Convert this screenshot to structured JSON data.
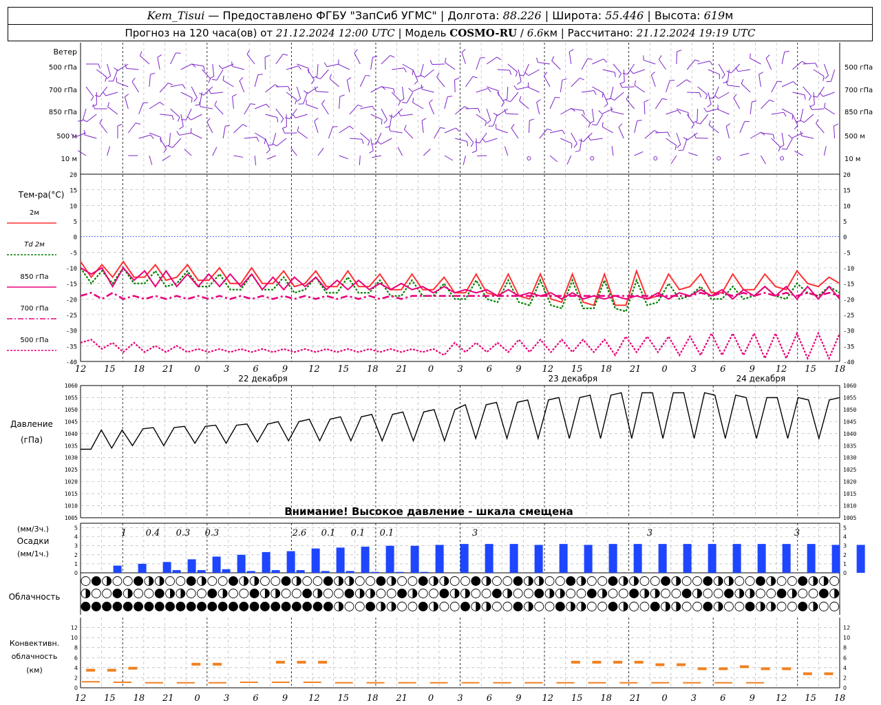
{
  "header": {
    "station": "Kem_Tisui",
    "provider": "Предоставлено ФГБУ \"ЗапСиб УГМС\"",
    "lon_label": "Долгота:",
    "lon": "88.226",
    "lat_label": "Широта:",
    "lat": "55.446",
    "alt_label": "Высота:",
    "alt": "619",
    "alt_unit": "м",
    "forecast_prefix": "Прогноз на 120 часа(ов) от",
    "run_time": "21.12.2024 12:00 UTC",
    "model_label": "Модель",
    "model": "COSMO-RU",
    "resolution": "6.6",
    "res_unit": "км",
    "calc_label": "Рассчитано:",
    "calc_time": "21.12.2024 19:19 UTC"
  },
  "labels": {
    "wind": "Ветер",
    "wind_levels": [
      "500 гПа",
      "700 гПа",
      "850 гПа",
      "500 м",
      "10  м"
    ],
    "temp_title": "Тем-ра(°C)",
    "legend": [
      "2м",
      "Td  2м",
      "850 гПа",
      "700 гПа",
      "500 гПа"
    ],
    "pressure": "Давление",
    "pressure_unit": "(гПа)",
    "warning": "Внимание! Высокое давление - шкала смещена",
    "precip_unit3": "(мм/3ч.)",
    "precip": "Осадки",
    "precip_unit1": "(мм/1ч.)",
    "cloud": "Облачность",
    "conv": [
      "Конвективн.",
      "облачность",
      "(км)"
    ]
  },
  "colors": {
    "t2m": "#ff3030",
    "td2m": "#008000",
    "t850": "#e8007a",
    "t700": "#e8007a",
    "t500": "#e8007a",
    "wind": "#7b22c8",
    "pressure": "#000000",
    "precip": "#1e46ff",
    "conv": "#f08020",
    "zero": "#3050ff"
  },
  "chart_data": [
    {
      "type": "line",
      "title": "Тем-ра(°C)",
      "x_start": "21.12.2024 12:00 UTC",
      "x_step_hours": 3,
      "ylim": [
        -40,
        20
      ],
      "yticks": [
        20,
        15,
        10,
        5,
        0,
        -5,
        -10,
        -15,
        -20,
        -25,
        -30,
        -35,
        -40
      ],
      "xtick_labels": [
        "12",
        "15",
        "18",
        "21",
        "0",
        "3",
        "6",
        "9",
        "12",
        "15",
        "18",
        "21",
        "0",
        "3",
        "6",
        "9",
        "12",
        "15",
        "18",
        "21",
        "0",
        "3",
        "6",
        "9",
        "12",
        "15",
        "18"
      ],
      "day_labels": [
        "22 декабря",
        "23 декабря",
        "24 декабря"
      ],
      "series": [
        {
          "name": "2м",
          "values": [
            -8,
            -13,
            -9,
            -13,
            -8,
            -13,
            -13,
            -9,
            -14,
            -13,
            -9,
            -14,
            -14,
            -10,
            -15,
            -15,
            -10,
            -15,
            -15,
            -11,
            -16,
            -15,
            -11,
            -16,
            -16,
            -11,
            -16,
            -16,
            -12,
            -17,
            -17,
            -12,
            -17,
            -17,
            -13,
            -18,
            -18,
            -12,
            -18,
            -19,
            -12,
            -19,
            -20,
            -12,
            -20,
            -21,
            -12,
            -21,
            -22,
            -12,
            -22,
            -22,
            -11,
            -20,
            -19,
            -12,
            -17,
            -16,
            -12,
            -18,
            -18,
            -12,
            -17,
            -17,
            -12,
            -16,
            -17,
            -11,
            -15,
            -16,
            -13,
            -15
          ]
        },
        {
          "name": "Td 2м",
          "values": [
            -10,
            -15,
            -11,
            -15,
            -10,
            -15,
            -15,
            -11,
            -16,
            -15,
            -11,
            -16,
            -16,
            -12,
            -17,
            -17,
            -12,
            -17,
            -17,
            -13,
            -18,
            -17,
            -13,
            -18,
            -18,
            -13,
            -18,
            -18,
            -14,
            -19,
            -19,
            -14,
            -19,
            -19,
            -15,
            -20,
            -20,
            -14,
            -20,
            -21,
            -14,
            -21,
            -22,
            -14,
            -22,
            -23,
            -14,
            -23,
            -23,
            -14,
            -23,
            -24,
            -14,
            -22,
            -21,
            -15,
            -20,
            -19,
            -16,
            -20,
            -20,
            -16,
            -20,
            -19,
            -16,
            -19,
            -20,
            -15,
            -18,
            -19,
            -16,
            -18
          ]
        },
        {
          "name": "850 гПа",
          "values": [
            -10,
            -12,
            -10,
            -16,
            -10,
            -14,
            -11,
            -16,
            -11,
            -16,
            -12,
            -16,
            -12,
            -16,
            -12,
            -16,
            -12,
            -17,
            -13,
            -17,
            -13,
            -16,
            -13,
            -17,
            -14,
            -17,
            -14,
            -17,
            -15,
            -17,
            -15,
            -17,
            -16,
            -18,
            -16,
            -18,
            -17,
            -18,
            -17,
            -19,
            -17,
            -19,
            -18,
            -19,
            -18,
            -20,
            -18,
            -20,
            -19,
            -20,
            -19,
            -20,
            -19,
            -20,
            -18,
            -20,
            -18,
            -19,
            -17,
            -19,
            -17,
            -20,
            -17,
            -19,
            -16,
            -19,
            -16,
            -20,
            -16,
            -20,
            -16,
            -20
          ]
        },
        {
          "name": "700 гПа",
          "values": [
            -19,
            -18,
            -20,
            -18,
            -20,
            -19,
            -20,
            -19,
            -20,
            -19,
            -20,
            -19,
            -20,
            -19,
            -20,
            -19,
            -20,
            -19,
            -20,
            -19,
            -20,
            -19,
            -20,
            -19,
            -20,
            -19,
            -20,
            -19,
            -20,
            -19,
            -20,
            -19,
            -19,
            -19,
            -19,
            -19,
            -19,
            -19,
            -19,
            -19,
            -19,
            -19,
            -19,
            -19,
            -19,
            -19,
            -19,
            -19,
            -19,
            -19,
            -19,
            -19,
            -19,
            -19,
            -19,
            -19,
            -19,
            -19,
            -18,
            -19,
            -18,
            -19,
            -18,
            -19,
            -18,
            -19,
            -18,
            -19,
            -18,
            -19,
            -18,
            -19
          ]
        },
        {
          "name": "500 гПа",
          "values": [
            -34,
            -33,
            -36,
            -34,
            -37,
            -34,
            -37,
            -35,
            -37,
            -35,
            -37,
            -36,
            -37,
            -36,
            -37,
            -36,
            -37,
            -36,
            -37,
            -36,
            -37,
            -36,
            -37,
            -36,
            -37,
            -36,
            -37,
            -36,
            -37,
            -36,
            -37,
            -36,
            -37,
            -36,
            -38,
            -34,
            -37,
            -34,
            -37,
            -34,
            -37,
            -33,
            -37,
            -33,
            -37,
            -33,
            -37,
            -33,
            -37,
            -33,
            -38,
            -32,
            -37,
            -32,
            -37,
            -32,
            -38,
            -32,
            -38,
            -31,
            -38,
            -31,
            -38,
            -31,
            -39,
            -31,
            -39,
            -31,
            -39,
            -31,
            -39,
            -31
          ]
        }
      ]
    },
    {
      "type": "line",
      "title": "Давление",
      "ylabel": "(гПа)",
      "ylim": [
        1005,
        1060
      ],
      "yticks": [
        1060,
        1055,
        1050,
        1045,
        1040,
        1035,
        1030,
        1025,
        1020,
        1015,
        1010,
        1005
      ],
      "series": [
        {
          "name": "Давление",
          "values": [
            1033.5,
            1033.5,
            1041.5,
            1034,
            1041.5,
            1035,
            1042,
            1042.5,
            1035,
            1042.5,
            1043,
            1036,
            1043,
            1043.5,
            1036,
            1043.5,
            1044,
            1036.5,
            1044,
            1045,
            1037,
            1045,
            1046,
            1037,
            1046,
            1047,
            1037,
            1047,
            1048,
            1037,
            1048,
            1049,
            1037,
            1049,
            1050,
            1037,
            1050,
            1052,
            1038,
            1052,
            1053,
            1038,
            1053,
            1054,
            1038,
            1054,
            1055,
            1038,
            1055,
            1056,
            1038,
            1056,
            1057,
            1038,
            1057,
            1057,
            1038,
            1057,
            1057,
            1038,
            1057,
            1056,
            1038,
            1056,
            1055,
            1038,
            1055,
            1055,
            1038,
            1055,
            1054,
            1038,
            1054,
            1055
          ]
        }
      ]
    },
    {
      "type": "bar",
      "title": "Осадки",
      "ylim": [
        0,
        5
      ],
      "yticks": [
        5,
        4,
        3,
        2,
        1,
        0
      ],
      "labels_3h": [
        "1",
        "0.4",
        "0.3",
        "0.3",
        "2.6",
        "0.1",
        "0.1",
        "0.1",
        "3",
        "3",
        "3"
      ],
      "bars_3h": [
        0.8,
        1,
        1.2,
        1.5,
        1.8,
        2,
        2.3,
        2.4,
        2.7,
        2.8,
        2.9,
        3,
        3,
        3.1,
        3.2,
        3.2,
        3.2,
        3.1,
        3.2,
        3.1,
        3.2,
        3.2,
        3.2,
        3.2,
        3.2,
        3.2,
        3.2,
        3.2,
        3.2,
        3.1,
        3.1
      ],
      "bars_1h": [
        0,
        0,
        0.3,
        0.3,
        0.4,
        0.2,
        0.3,
        0.3,
        0.2,
        0.2,
        0.1,
        0.1,
        0.1,
        0,
        0,
        0,
        0,
        0,
        0,
        0,
        0,
        0,
        0,
        0,
        0,
        0,
        0,
        0,
        0,
        0,
        0
      ]
    },
    {
      "type": "bar",
      "title": "Конвективн. облачность",
      "ylabel": "(км)",
      "ylim": [
        0,
        14
      ],
      "yticks": [
        12,
        10,
        8,
        6,
        4,
        2,
        0
      ],
      "tops": [
        3.5,
        3.5,
        3.9,
        null,
        null,
        4.7,
        4.7,
        null,
        null,
        5.1,
        5.1,
        5.1,
        null,
        null,
        null,
        null,
        null,
        null,
        null,
        null,
        null,
        null,
        null,
        5.1,
        5.1,
        5.1,
        5.1,
        4.6,
        4.6,
        3.8,
        3.8,
        4.2,
        3.8,
        3.8,
        2.8,
        2.8
      ],
      "bases": [
        1.2,
        1.1,
        1,
        1,
        1,
        1.1,
        1.1,
        1.1,
        1,
        1,
        1,
        1,
        1,
        1,
        1,
        1,
        1,
        1,
        1,
        1,
        1,
        1
      ]
    }
  ]
}
